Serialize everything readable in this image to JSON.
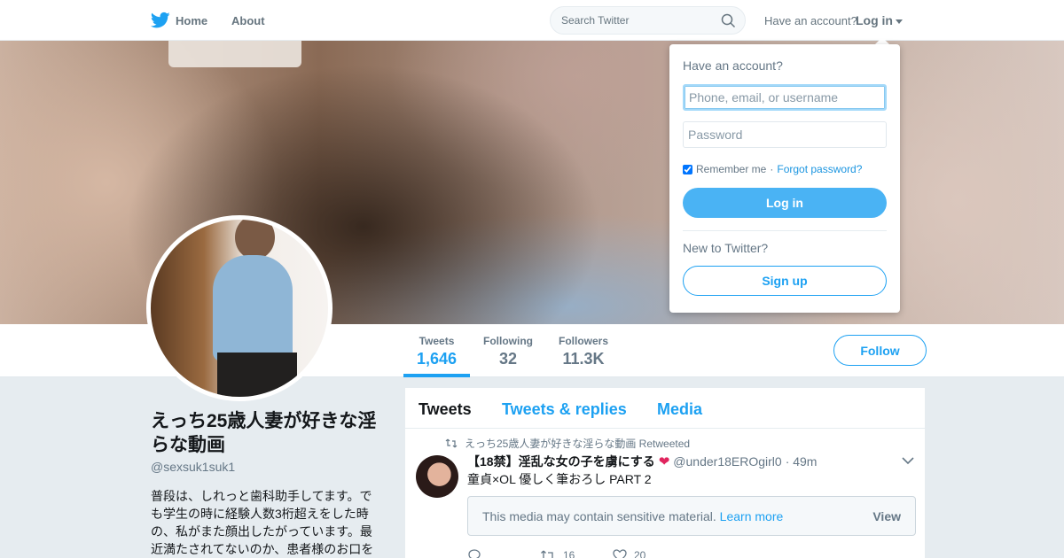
{
  "nav": {
    "home": "Home",
    "about": "About",
    "search_placeholder": "Search Twitter",
    "have_account": "Have an account?",
    "login": "Log in"
  },
  "profile": {
    "name": "えっち25歳人妻が好きな淫らな動画",
    "handle": "@sexsuk1suk1",
    "bio": "普段は、しれっと歯科助手してます。でも学生の時に経験人数3桁超えをした時の、私がまた顔出したがっています。最近満たされてないのか、患者様のお口を",
    "follow_label": "Follow"
  },
  "stats": [
    {
      "label": "Tweets",
      "value": "1,646"
    },
    {
      "label": "Following",
      "value": "32"
    },
    {
      "label": "Followers",
      "value": "11.3K"
    }
  ],
  "timeline": {
    "tabs": [
      "Tweets",
      "Tweets & replies",
      "Media"
    ],
    "tweet": {
      "retweeted_by": "えっち25歳人妻が好きな淫らな動画 Retweeted",
      "name": "【18禁】淫乱な女の子を虜にする",
      "handle": "@under18EROgirl0",
      "time": "· 49m",
      "text": "童貞×OL 優しく筆おろし PART 2",
      "sensitive_text": "This media may contain sensitive material.",
      "learn_more": "Learn more",
      "view": "View",
      "retweets": "16",
      "likes": "20"
    }
  },
  "login_dropdown": {
    "title": "Have an account?",
    "username_placeholder": "Phone, email, or username",
    "password_placeholder": "Password",
    "remember": "Remember me",
    "separator": "·",
    "forgot": "Forgot password?",
    "login_button": "Log in",
    "new_to_twitter": "New to Twitter?",
    "signup_button": "Sign up",
    "remember_checked": true
  },
  "colors": {
    "brand_blue": "#1da1f2",
    "login_button": "#4ab3f4",
    "text_secondary": "#657786",
    "background": "#e6ecf0"
  }
}
